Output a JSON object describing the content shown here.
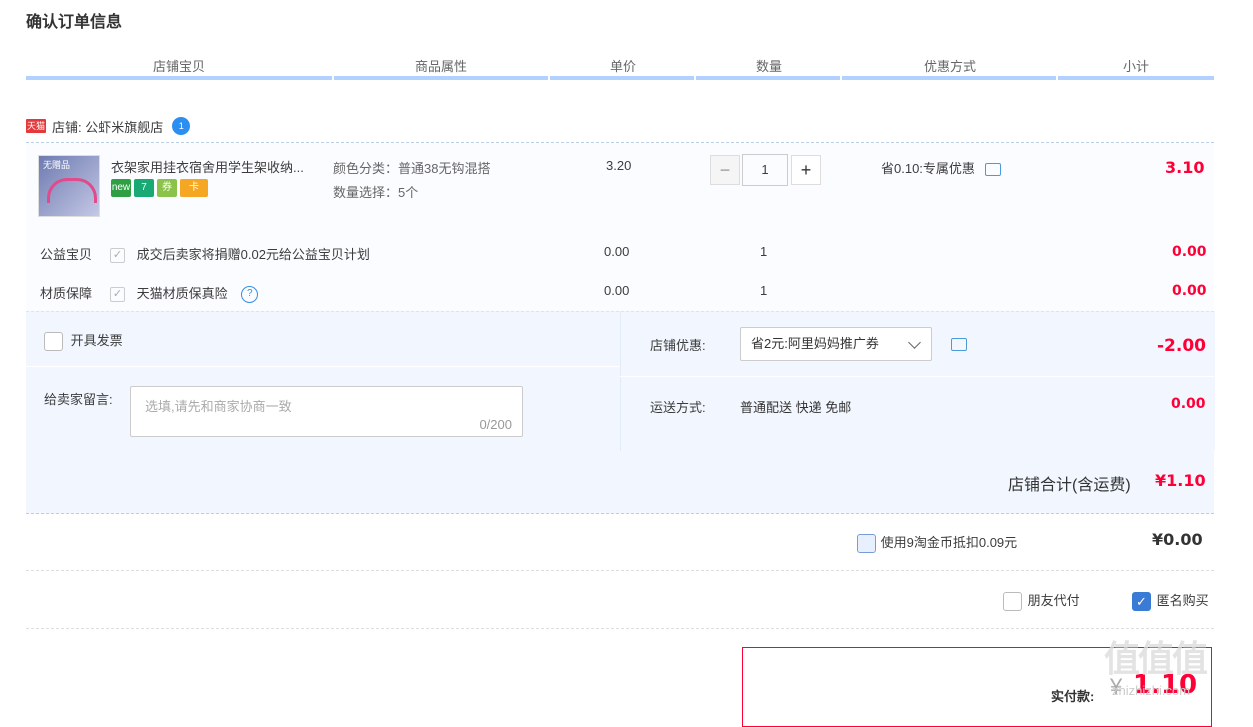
{
  "page": {
    "title": "确认订单信息"
  },
  "columns": [
    "店铺宝贝",
    "商品属性",
    "单价",
    "数量",
    "优惠方式",
    "小计"
  ],
  "shop": {
    "label": "店铺: 公虾米旗舰店",
    "tmall_badge": "天猫",
    "ww_badge": "1"
  },
  "item": {
    "thumb_text": "无赠品",
    "name": "衣架家用挂衣宿舍用学生架收纳...",
    "attr_color": "颜色分类：普通38无钩混搭",
    "attr_qty": "数量选择：5个",
    "price": "3.20",
    "quantity": "1",
    "discount": "省0.10:专属优惠",
    "subtotal": "3.10",
    "badges": [
      {
        "text": "new",
        "color": "#2ea043"
      },
      {
        "text": "7",
        "color": "#19a974"
      },
      {
        "text": "券",
        "color": "#8bc34a"
      },
      {
        "text": "卡",
        "color": "#f5a623"
      }
    ]
  },
  "services": [
    {
      "label": "公益宝贝",
      "desc": "成交后卖家将捐赠0.02元给公益宝贝计划",
      "price": "0.00",
      "qty": "1",
      "subtotal": "0.00"
    },
    {
      "label": "材质保障",
      "desc": "天猫材质保真险",
      "price": "0.00",
      "qty": "1",
      "subtotal": "0.00"
    }
  ],
  "invoice": {
    "label": "开具发票"
  },
  "message": {
    "label": "给卖家留言:",
    "placeholder": "选填,请先和商家协商一致",
    "count": "0/200"
  },
  "shop_discount": {
    "label": "店铺优惠:",
    "selected": "省2元:阿里妈妈推广券",
    "amount": "-2.00"
  },
  "shipping": {
    "label": "运送方式:",
    "value": "普通配送 快递 免邮",
    "amount": "0.00"
  },
  "shop_total": {
    "label": "店铺合计(含运费)",
    "amount": "¥1.10"
  },
  "coins": {
    "label": "使用9淘金币抵扣0.09元",
    "amount": "¥0.00"
  },
  "options": {
    "friend_pay": "朋友代付",
    "anonymous": "匿名购买"
  },
  "pay": {
    "label": "实付款:",
    "currency": "¥",
    "amount": "1.10"
  },
  "watermark": {
    "text": "值值值",
    "sub": "zhizhizhi.com"
  },
  "colors": {
    "accent": "#ff0036",
    "header_bar": "#b2d1ff",
    "checkbox_on": "#3a7bd5"
  }
}
